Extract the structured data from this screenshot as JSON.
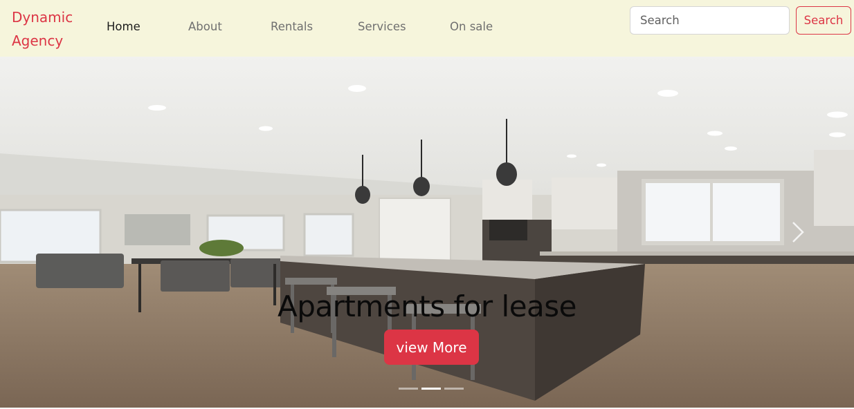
{
  "navbar": {
    "brand": "Dynamic Agency",
    "links": [
      {
        "label": "Home",
        "active": true
      },
      {
        "label": "About",
        "active": false
      },
      {
        "label": "Rentals",
        "active": false
      },
      {
        "label": "Services",
        "active": false
      },
      {
        "label": "On sale",
        "active": false
      }
    ],
    "search": {
      "placeholder": "Search",
      "value": "",
      "button_label": "Search"
    }
  },
  "carousel": {
    "caption": "Apartments for lease",
    "button_label": "view More",
    "slide_count": 3,
    "active_slide": 2,
    "next_icon": "chevron-right-icon"
  },
  "colors": {
    "brand": "#dc3545",
    "navbar_bg": "#f6f5dc",
    "nav_active": "#1c1c1c",
    "nav_inactive": "#6f6f6f"
  }
}
